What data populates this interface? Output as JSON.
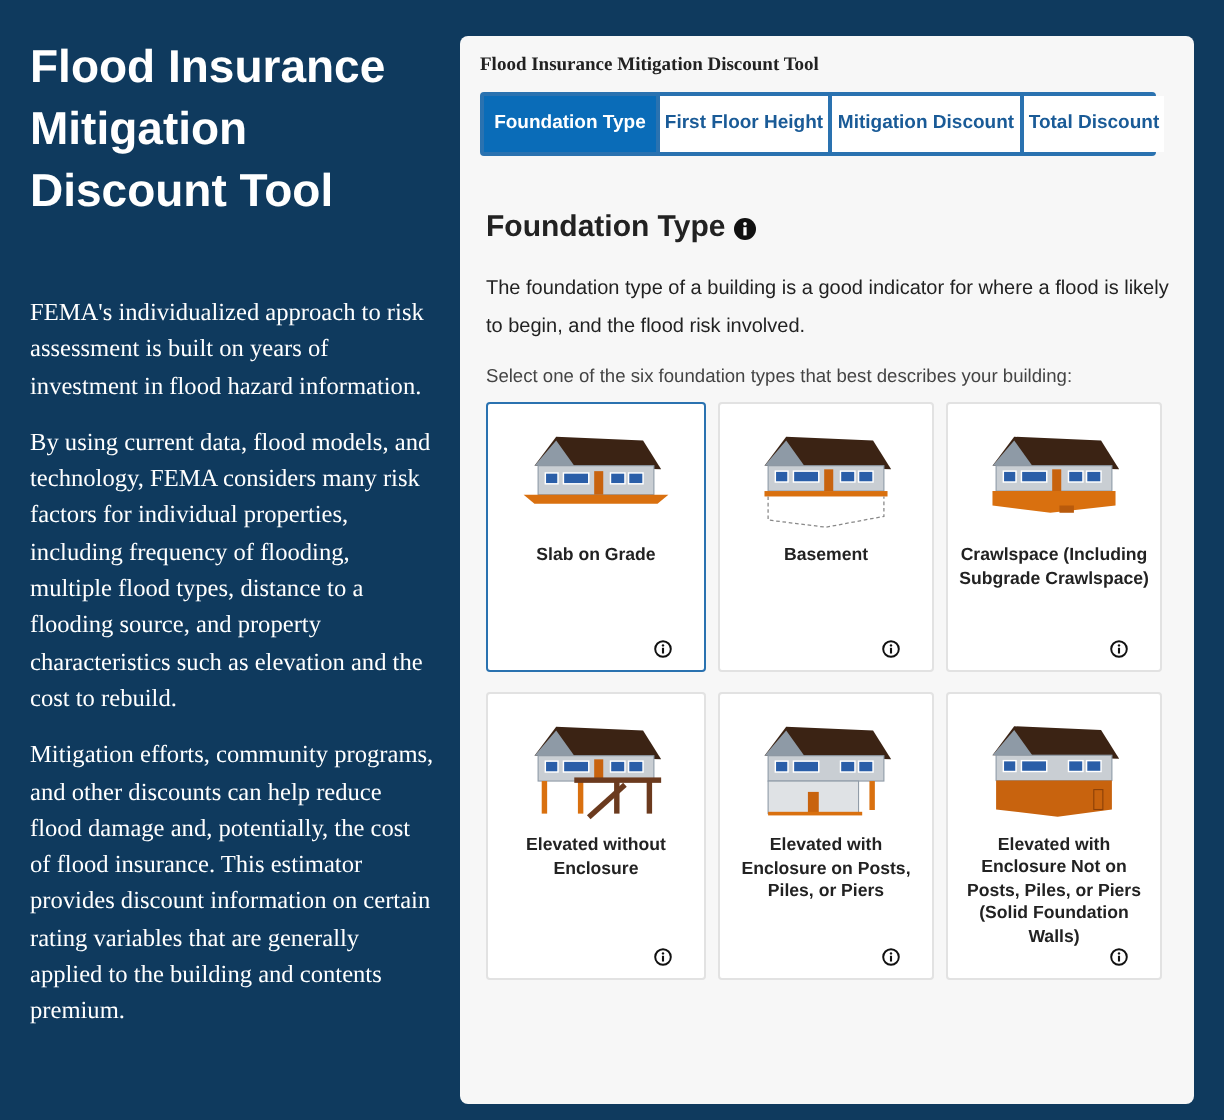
{
  "intro": {
    "title": "Flood Insurance Mitigation Discount Tool",
    "paragraphs": [
      "FEMA's individualized approach to risk assessment is built on years of investment in flood hazard information.",
      "By using current data, flood models, and technology, FEMA considers many risk factors for individual properties, including frequency of flooding, multiple flood types, distance to a flooding source, and property characteristics such as elevation and the cost to rebuild.",
      "Mitigation efforts, community programs, and other discounts can help reduce flood damage and, potentially, the cost of flood insurance. This estimator provides discount information on certain rating variables that are generally applied to the building and contents premium."
    ]
  },
  "tool": {
    "title": "Flood Insurance Mitigation Discount Tool",
    "tabs": [
      {
        "label": "Foundation Type",
        "selected": true
      },
      {
        "label": "First Floor Height",
        "selected": false
      },
      {
        "label": "Mitigation Discount",
        "selected": false
      },
      {
        "label": "Total Discount",
        "selected": false
      }
    ],
    "heading": "Foundation Type",
    "description": "The foundation type of a building is a good indicator for where a flood is likely to begin, and the flood risk involved.",
    "prompt": "Select one of the six foundation types that best describes your building:",
    "options": [
      {
        "label": "Slab on Grade",
        "kind": "slab",
        "selected": true
      },
      {
        "label": "Basement",
        "kind": "basement",
        "selected": false
      },
      {
        "label": "Crawlspace (Including Subgrade Crawlspace)",
        "kind": "crawlspace",
        "selected": false
      },
      {
        "label": "Elevated without Enclosure",
        "kind": "open",
        "selected": false
      },
      {
        "label": "Elevated with Enclosure on Posts, Piles, or Piers",
        "kind": "posts",
        "selected": false
      },
      {
        "label": "Elevated with Enclosure Not on Posts, Piles, or Piers (Solid Foundation Walls)",
        "kind": "solid",
        "selected": false
      }
    ]
  }
}
